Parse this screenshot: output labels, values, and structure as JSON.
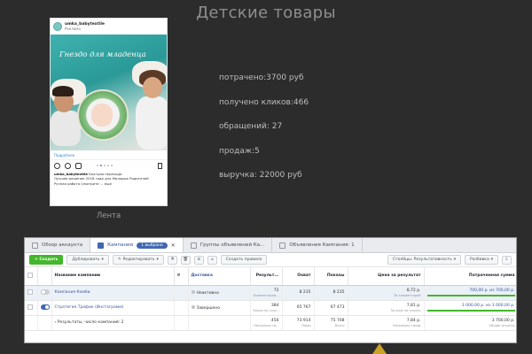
{
  "title": "Детские товары",
  "post": {
    "username": "umka_babytextile",
    "location": "Реклама",
    "banner_text": "Гнездо для младенца",
    "more_link": "Подробнее",
    "caption_user": "umka_babytextile",
    "caption_lines": [
      "Быстрая переходи",
      "Лучшее решение 2018 года для Молодых Родителей",
      "Ручная работа (смотрите ... еще"
    ],
    "carousel_count": 5,
    "carousel_active": 1
  },
  "post_caption": "Лента",
  "stats": [
    "потрачено:3700 руб",
    "получено кликов:466",
    "обращений: 27",
    "продаж:5",
    "выручка: 22000 руб"
  ],
  "ads_manager": {
    "tabs": [
      {
        "label": "Обзор аккаунта",
        "icon": "overview-icon"
      },
      {
        "label": "Кампании",
        "icon": "campaign-icon",
        "chip": "1 выбрано"
      },
      {
        "label": "Группы объявлений Ка...",
        "icon": "adset-icon"
      },
      {
        "label": "Объявления Кампания: 1",
        "icon": "ad-icon"
      }
    ],
    "toolbar": {
      "create": "+ Создать",
      "duplicate": "Дублировать",
      "edit": "Редактировать",
      "create_rule": "Создать правило",
      "columns": "Столбцы: Результативность",
      "breakdown": "Разбивка"
    },
    "columns": [
      "Название кампании",
      "Доставка",
      "Результ...",
      "Охват",
      "Показы",
      "Цена за результат",
      "Потраченная сумма"
    ],
    "rows": [
      {
        "name": "Кампания Комби",
        "delivery": "Неактивно",
        "results": "72",
        "results_sub": "Комментарии...",
        "reach": "8 235",
        "impressions": "8 235",
        "cpr": "8,72 р.",
        "cpr_sub": "За комментарий",
        "spent": "700,00 р. из 700,00 р.",
        "spent_fill": 1.0,
        "toggle_on": false,
        "status": "inactive"
      },
      {
        "name": "Стратегия Трафик (Инстаграмм)",
        "delivery": "Завершено",
        "results": "384",
        "results_sub": "Клики по ссыл...",
        "reach": "65 767",
        "impressions": "67 473",
        "cpr": "7,81 р.",
        "cpr_sub": "За клик по ссылке",
        "spent": "3 000,00 р. из 3 000,00 р.",
        "spent_fill": 1.0,
        "toggle_on": true,
        "status": "completed"
      }
    ],
    "total": {
      "name": "Результаты, число кампаний: 2",
      "results": "456",
      "results_sub": "Несколько ти...",
      "reach": "73 914",
      "reach_sub": "Люди",
      "impressions": "75 708",
      "impressions_sub": "Всего",
      "cpr": "7,84 р.",
      "cpr_sub": "Несколько типов",
      "spent": "3 700,00 р.",
      "spent_sub": "Общие затраты"
    }
  },
  "colors": {
    "background": "#2c2c2c",
    "accent_blue": "#4267b2",
    "accent_green": "#42b72a",
    "pointer": "#c9a227"
  }
}
